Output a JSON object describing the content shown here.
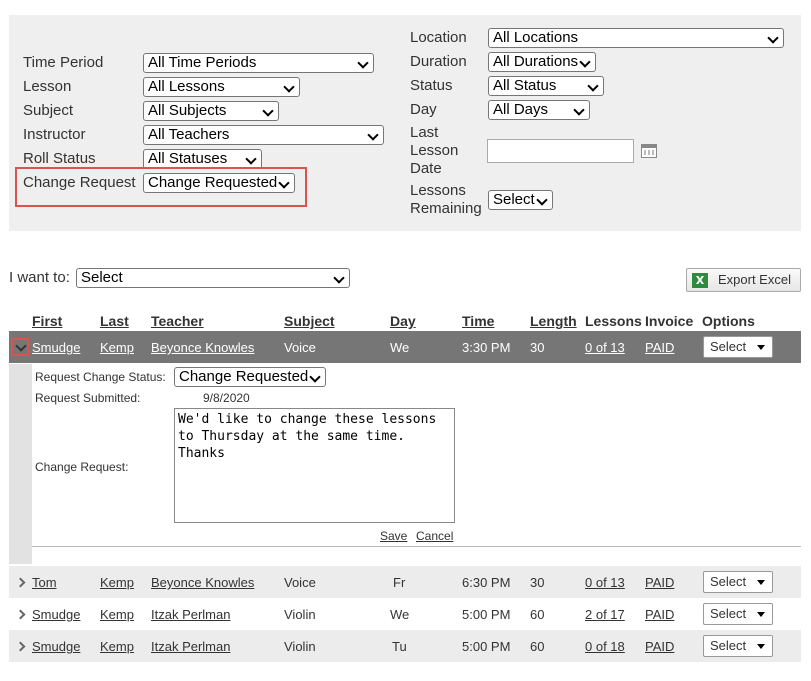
{
  "filters": {
    "left": [
      {
        "label": "Time Period",
        "value": "All Time Periods"
      },
      {
        "label": "Lesson",
        "value": "All Lessons"
      },
      {
        "label": "Subject",
        "value": "All Subjects"
      },
      {
        "label": "Instructor",
        "value": "All Teachers"
      },
      {
        "label": "Roll Status",
        "value": "All Statuses"
      },
      {
        "label": "Change Request",
        "value": "Change Requested"
      }
    ],
    "right": [
      {
        "label": "Location",
        "value": "All Locations"
      },
      {
        "label": "Duration",
        "value": "All Durations"
      },
      {
        "label": "Status",
        "value": "All Status"
      },
      {
        "label": "Day",
        "value": "All Days"
      }
    ],
    "last_lesson_date": {
      "label_1": "Last",
      "label_2": "Lesson",
      "label_3": "Date",
      "value": ""
    },
    "lessons_remaining": {
      "label_1": "Lessons",
      "label_2": "Remaining",
      "value": "Select"
    }
  },
  "toolbar": {
    "i_want_to_label": "I want to:",
    "action_value": "Select",
    "export_label": "Export Excel"
  },
  "table": {
    "headers": [
      "First",
      "Last",
      "Teacher",
      "Subject",
      "Day",
      "Time",
      "Length",
      "Lessons",
      "Invoice",
      "Options"
    ],
    "rows": [
      {
        "first": "Smudge",
        "last": "Kemp",
        "teacher": "Beyonce Knowles",
        "subject": "Voice",
        "day": "We",
        "time": "3:30 PM",
        "length": "30",
        "lessons": "0 of 13",
        "invoice": "PAID",
        "options": "Select"
      },
      {
        "first": "Tom",
        "last": "Kemp",
        "teacher": "Beyonce Knowles",
        "subject": "Voice",
        "day": "Fr",
        "time": "6:30 PM",
        "length": "30",
        "lessons": "0 of 13",
        "invoice": "PAID",
        "options": "Select"
      },
      {
        "first": "Smudge",
        "last": "Kemp",
        "teacher": "Itzak Perlman",
        "subject": "Violin",
        "day": "We",
        "time": "5:00 PM",
        "length": "60",
        "lessons": "2 of 17",
        "invoice": "PAID",
        "options": "Select"
      },
      {
        "first": "Smudge",
        "last": "Kemp",
        "teacher": "Itzak Perlman",
        "subject": "Violin",
        "day": "Tu",
        "time": "5:00 PM",
        "length": "60",
        "lessons": "0 of 18",
        "invoice": "PAID",
        "options": "Select"
      }
    ]
  },
  "detail": {
    "status_label": "Request Change Status:",
    "status_value": "Change Requested",
    "submitted_label": "Request Submitted:",
    "submitted_value": "9/8/2020",
    "change_request_label": "Change Request:",
    "change_request_text": "We'd like to change these lessons\nto Thursday at the same time.\nThanks",
    "save_label": "Save",
    "cancel_label": "Cancel"
  },
  "colors": {
    "filter_bg": "#efefef",
    "selected_row_bg": "#767676",
    "alt_row_bg": "#ececec",
    "highlight": "#d9534f"
  }
}
